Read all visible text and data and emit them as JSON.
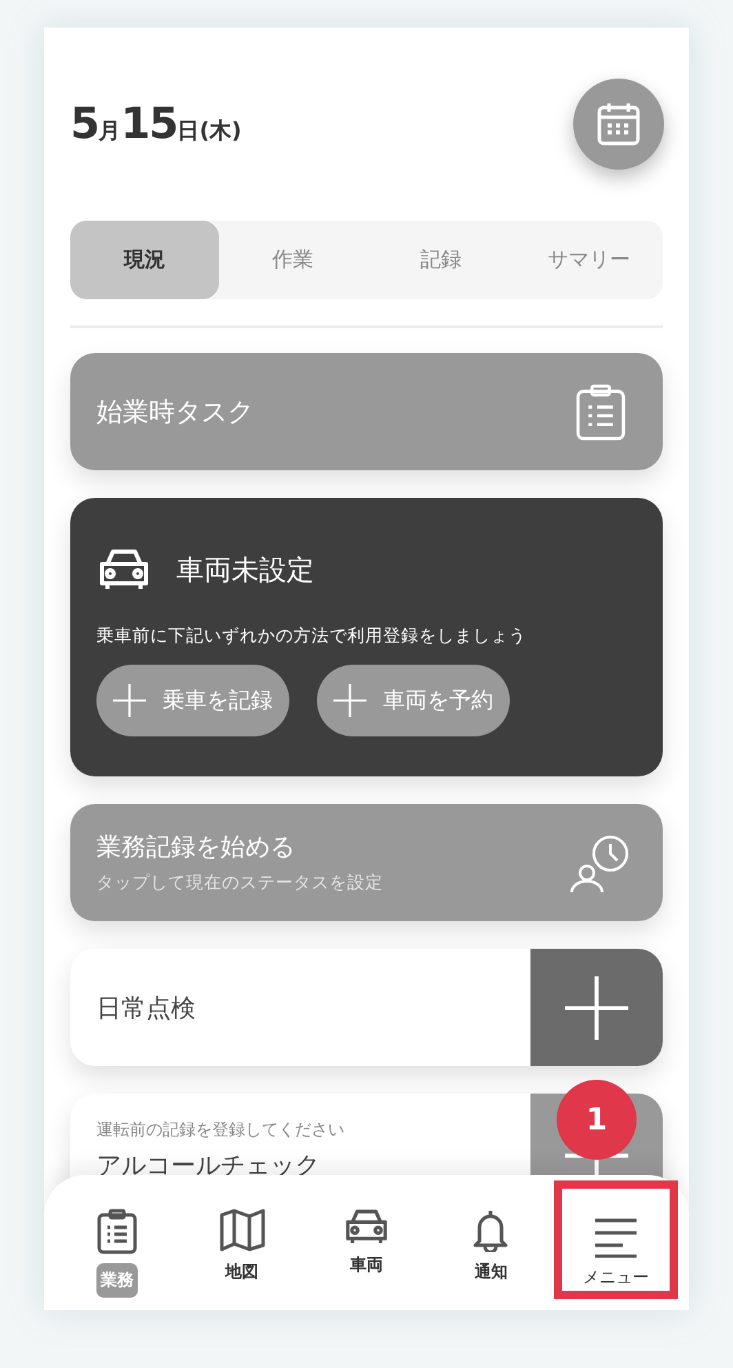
{
  "date": [
    {
      "text": "5",
      "kind": "number"
    },
    {
      "text": "月",
      "kind": "unit"
    },
    {
      "text": "15",
      "kind": "number"
    },
    {
      "text": "日(木)",
      "kind": "unit"
    }
  ],
  "tabs": [
    {
      "label": "現況",
      "selected": true
    },
    {
      "label": "作業",
      "selected": false
    },
    {
      "label": "記録",
      "selected": false
    },
    {
      "label": "サマリー",
      "selected": false
    }
  ],
  "start_task": {
    "title": "始業時タスク"
  },
  "vehicle_card": {
    "title": "車両未設定",
    "message": "乗車前に下記いずれかの方法で利用登録をしましょう",
    "buttons": [
      "乗車を記録",
      "車両を予約"
    ]
  },
  "work_record": {
    "title": "業務記録を始める",
    "subtitle": "タップして現在のステータスを設定"
  },
  "checks": [
    {
      "title": "日常点検",
      "disabled": false
    },
    {
      "subtitle": "運転前の記録を登録してください",
      "title": "アルコールチェック",
      "disabled": true
    }
  ],
  "bottom_nav": [
    {
      "label": "業務",
      "kind": "clipboard",
      "selected": true,
      "highlighted": false
    },
    {
      "label": "地図",
      "kind": "map",
      "selected": false,
      "highlighted": false
    },
    {
      "label": "車両",
      "kind": "car",
      "selected": false,
      "highlighted": false
    },
    {
      "label": "通知",
      "kind": "bell",
      "selected": false,
      "highlighted": false
    },
    {
      "label": "メニュー",
      "kind": "menu",
      "selected": false,
      "highlighted": true
    }
  ],
  "callout": {
    "number": "1"
  }
}
